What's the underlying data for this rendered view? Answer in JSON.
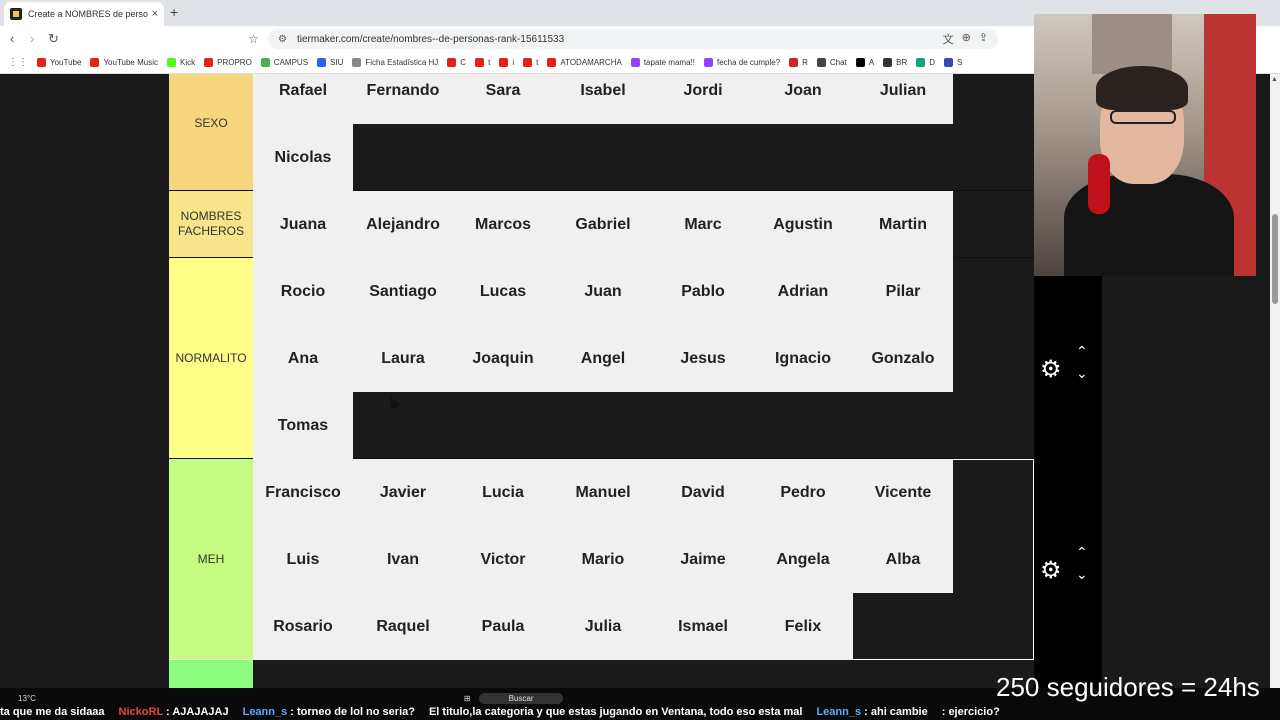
{
  "browser": {
    "tab_title": "Create a NOMBRES de personas",
    "tab_close": "×",
    "new_tab": "+",
    "url": "tiermaker.com/create/nombres--de-personas-rank-15611533",
    "nav_back": "‹",
    "nav_forward": "›",
    "nav_reload": "↻",
    "bookmarks": [
      {
        "label": "YouTube",
        "color": "#e62117"
      },
      {
        "label": "YouTube Music",
        "color": "#e62117"
      },
      {
        "label": "Kick",
        "color": "#53fc18"
      },
      {
        "label": "PROPRO",
        "color": "#e62117"
      },
      {
        "label": "CAMPUS",
        "color": "#4caf50"
      },
      {
        "label": "SIU",
        "color": "#2962ff"
      },
      {
        "label": "Ficha Estadística HJ",
        "color": "#888888"
      },
      {
        "label": "C",
        "color": "#e62117"
      },
      {
        "label": "t",
        "color": "#e62117"
      },
      {
        "label": "i",
        "color": "#e62117"
      },
      {
        "label": "t",
        "color": "#e62117"
      },
      {
        "label": "ATODAMARCHA",
        "color": "#e62117"
      },
      {
        "label": "tapate mama!!",
        "color": "#9146ff"
      },
      {
        "label": "fecha de cumple?",
        "color": "#9146ff"
      },
      {
        "label": "R",
        "color": "#c62828"
      },
      {
        "label": "Chat",
        "color": "#444444"
      },
      {
        "label": "A",
        "color": "#000000"
      },
      {
        "label": "BR",
        "color": "#333333"
      },
      {
        "label": "D",
        "color": "#10a37f"
      },
      {
        "label": "S",
        "color": "#3949ab"
      }
    ]
  },
  "tiers": [
    {
      "label": "SEXO",
      "color": "#f6d77d",
      "rows": 2,
      "items": [
        "Rafael",
        "Fernando",
        "Sara",
        "Isabel",
        "Jordi",
        "Joan",
        "Julian",
        "Nicolas"
      ]
    },
    {
      "label": "NOMBRES FACHEROS",
      "color": "#f8e48a",
      "rows": 1,
      "items": [
        "Juana",
        "Alejandro",
        "Marcos",
        "Gabriel",
        "Marc",
        "Agustin",
        "Martin"
      ]
    },
    {
      "label": "NORMALITO",
      "color": "#fdfd88",
      "rows": 3,
      "items": [
        "Rocio",
        "Santiago",
        "Lucas",
        "Juan",
        "Pablo",
        "Adrian",
        "Pilar",
        "Ana",
        "Laura",
        "Joaquin",
        "Angel",
        "Jesus",
        "Ignacio",
        "Gonzalo",
        "Tomas"
      ]
    },
    {
      "label": "MEH",
      "color": "#c5fb80",
      "rows": 3,
      "items": [
        "Francisco",
        "Javier",
        "Lucia",
        "Manuel",
        "David",
        "Pedro",
        "Vicente",
        "Luis",
        "Ivan",
        "Victor",
        "Mario",
        "Jaime",
        "Angela",
        "Alba",
        "Rosario",
        "Raquel",
        "Paula",
        "Julia",
        "Ismael",
        "Felix"
      ]
    },
    {
      "label": "",
      "color": "#8dfb80",
      "rows": 1,
      "items": []
    }
  ],
  "controls": {
    "gear": "⚙",
    "up": "⌃",
    "down": "⌄"
  },
  "overlay": {
    "followers": "250 seguidores = 24hs",
    "weather": "13°C",
    "search": "Buscar",
    "chat": [
      {
        "user": "",
        "text": "ta que me da sidaaa"
      },
      {
        "user": "NickoRL",
        "text": ": AJAJAJAJ"
      },
      {
        "user": "Leann_s",
        "text": ": torneo de lol no seria?"
      },
      {
        "user": "",
        "text": "El titulo,la categoria y que estas jugando en Ventana, todo eso esta mal"
      },
      {
        "user": "Leann_s",
        "text": ": ahi cambie"
      },
      {
        "user": "",
        "text": ": ejercicio?"
      }
    ]
  }
}
